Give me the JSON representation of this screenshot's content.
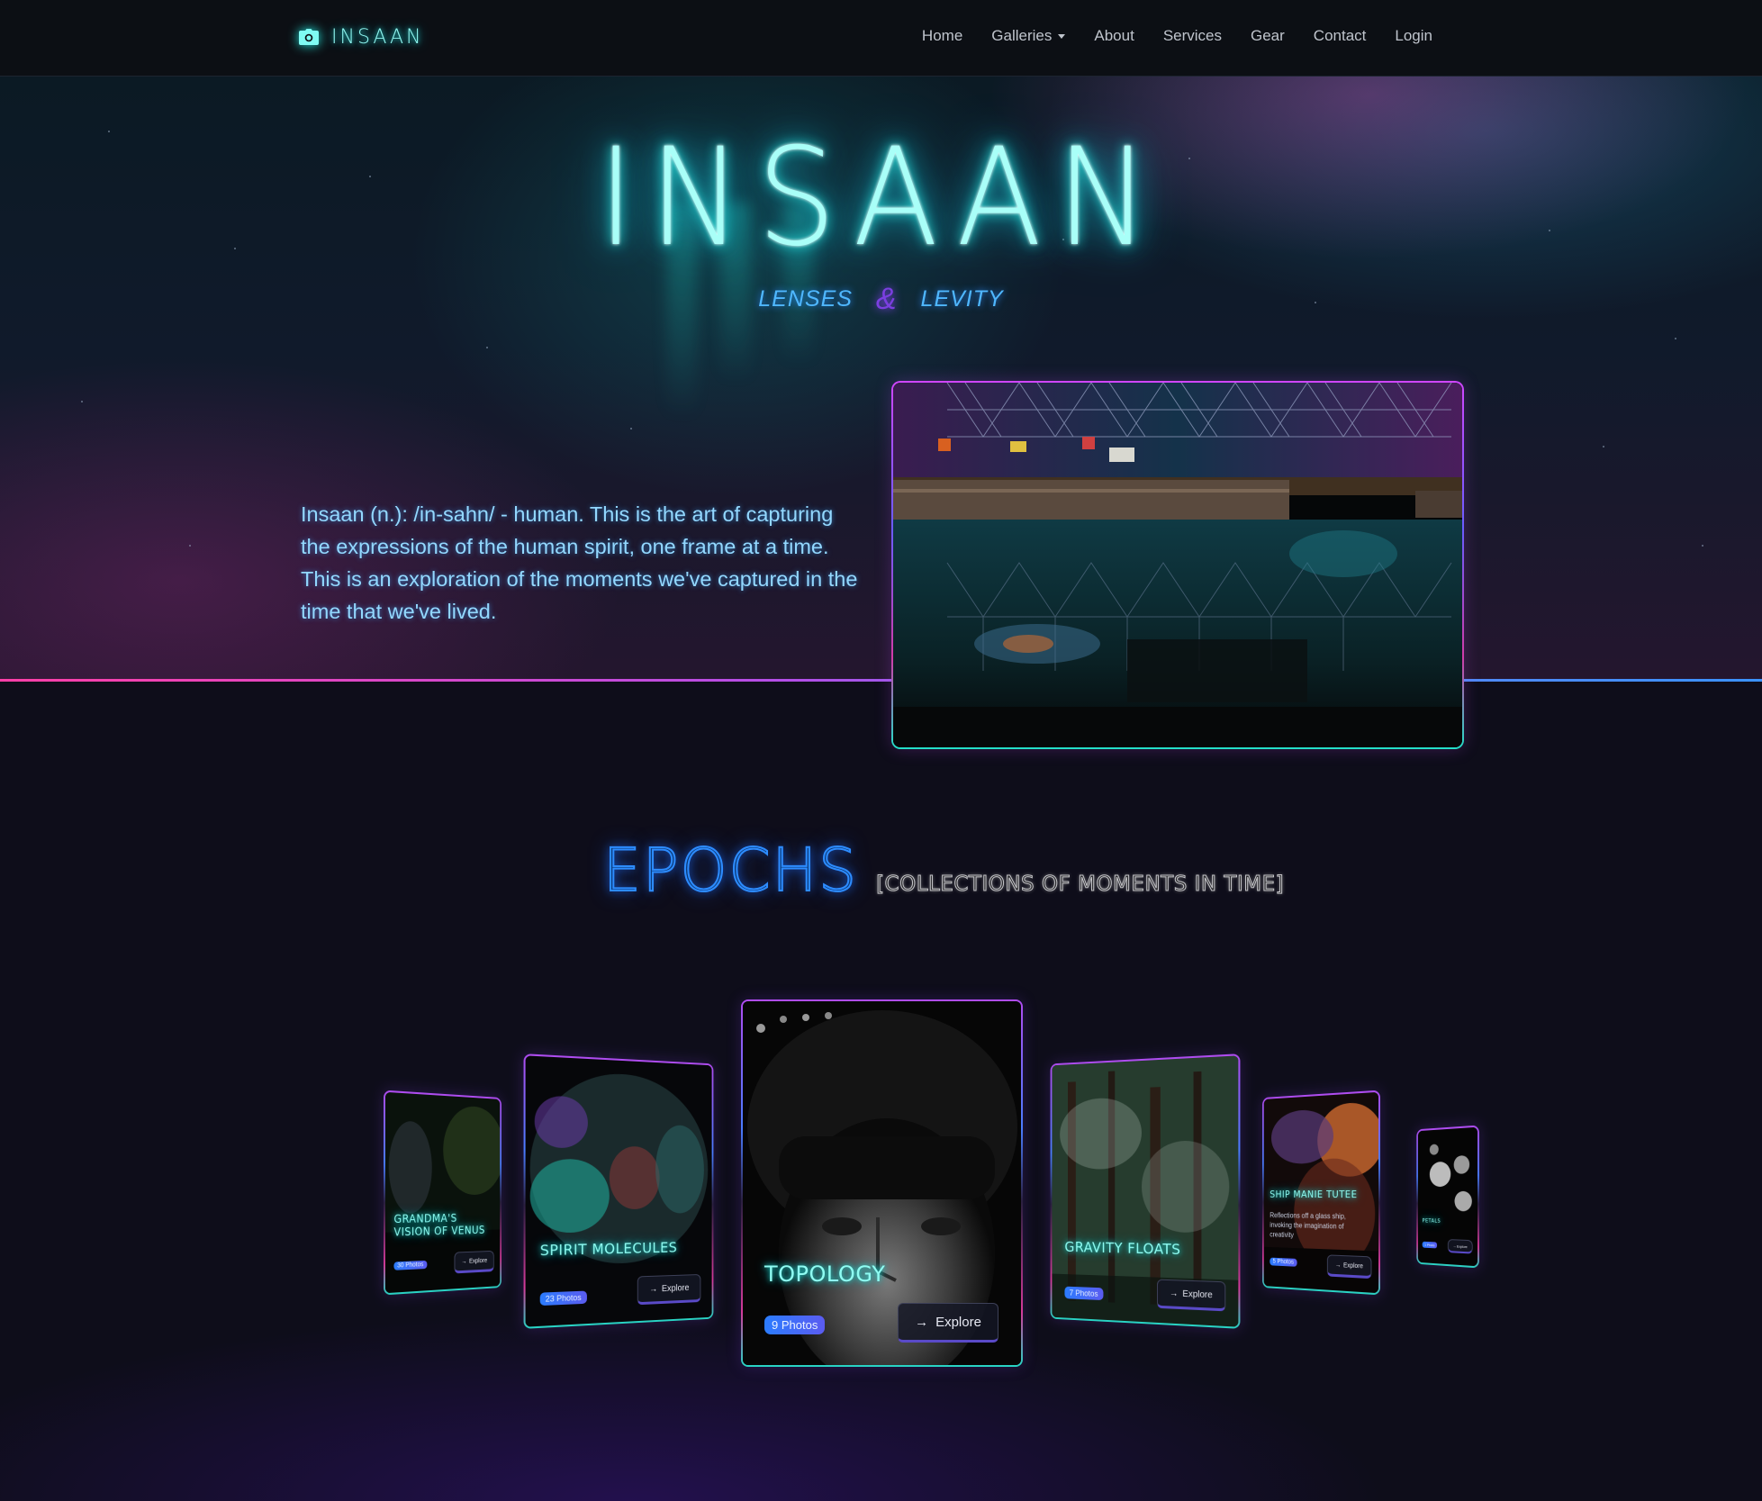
{
  "brand": {
    "name": "INSAAN",
    "icon": "camera-icon"
  },
  "nav": {
    "items": [
      "Home",
      "Galleries",
      "About",
      "Services",
      "Gear",
      "Contact",
      "Login"
    ],
    "galleries_has_dropdown": true
  },
  "hero": {
    "title": "INSAAN",
    "tagline_left": "LENSES",
    "tagline_amp": "&",
    "tagline_right": "LEVITY",
    "intro": "Insaan (n.): /in-sahn/ - human. This is the art of capturing the expressions of the human spirit, one frame at a time. This is an exploration of the moments we've captured in the time that we've lived."
  },
  "epochs": {
    "title": "EPOCHS",
    "subtitle": "[COLLECTIONS OF MOMENTS IN TIME]"
  },
  "cards": [
    {
      "title": "GRANDMA'S VISION OF VENUS",
      "badge": "30 Photos",
      "button": "Explore"
    },
    {
      "title": "SPIRIT MOLECULES",
      "badge": "23 Photos",
      "button": "Explore"
    },
    {
      "title": "TOPOLOGY",
      "badge": "9 Photos",
      "button": "Explore"
    },
    {
      "title": "GRAVITY FLOATS",
      "badge": "7 Photos",
      "button": "Explore"
    },
    {
      "title": "SHIP MANIE TUTEE",
      "description": "Reflections off a glass ship, invoking the imagination of creativity",
      "badge": "5 Photos",
      "button": "Explore"
    },
    {
      "title": "PETALS",
      "badge": "1 Photo",
      "button": "Explore"
    }
  ],
  "colors": {
    "neon_cyan": "#2af4ec",
    "neon_blue": "#2d8cff",
    "neon_pink": "#ff3fa7",
    "neon_purple": "#8a46ff",
    "background": "#0e0d1a"
  }
}
